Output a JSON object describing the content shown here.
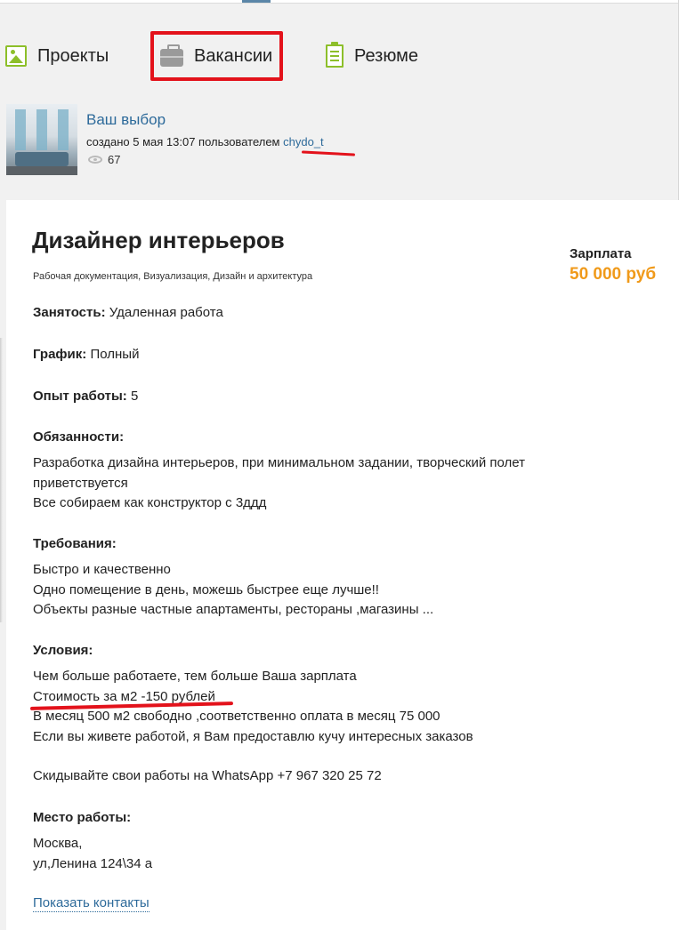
{
  "nav": {
    "tabs": [
      {
        "label": "Проекты",
        "icon": "image-icon"
      },
      {
        "label": "Вакансии",
        "icon": "briefcase-icon"
      },
      {
        "label": "Резюме",
        "icon": "clipboard-icon"
      }
    ],
    "active_tab": "Вакансии"
  },
  "author": {
    "title": "Ваш выбор",
    "meta_prefix": "создано 5 мая 13:07 пользователем",
    "username": "chydo_t",
    "views": "67"
  },
  "job": {
    "title": "Дизайнер интерьеров",
    "tags": "Рабочая документация, Визуализация, Дизайн и архитектура",
    "salary_label": "Зарплата",
    "salary_value": "50 000 руб",
    "employment_label": "Занятость:",
    "employment_value": "Удаленная работа",
    "schedule_label": "График:",
    "schedule_value": "Полный",
    "experience_label": "Опыт работы:",
    "experience_value": "5",
    "duties_heading": "Обязанности:",
    "duties_lines": [
      "Разработка дизайна интерьеров, при минимальном задании, творческий полет",
      "приветствуется",
      "Все собираем как конструктор с 3ддд"
    ],
    "requirements_heading": "Требования:",
    "requirements_lines": [
      "Быстро и качественно",
      "Одно помещение в день, можешь быстрее еще лучше!!",
      "Объекты разные частные апартаменты, рестораны ,магазины ..."
    ],
    "conditions_heading": "Условия:",
    "conditions_lines": [
      "Чем больше работаете, тем больше Ваша зарплата",
      "Стоимость за м2 -150 рублей",
      "В месяц 500 м2 свободно ,соответственно оплата в месяц 75 000",
      "Если вы живете работой, я Вам предоставлю кучу интересных заказов"
    ],
    "send_works": "Скидывайте свои работы на WhatsApp +7 967 320 25 72",
    "location_heading": "Место работы:",
    "location_lines": [
      "Москва,",
      "ул,Ленина 124\\34 а"
    ],
    "contacts_link": "Показать контакты"
  },
  "colors": {
    "accent_link": "#2d6a9a",
    "salary": "#f09a1a",
    "annotation_red": "#e3121b",
    "icon_green": "#8dbf2a"
  }
}
